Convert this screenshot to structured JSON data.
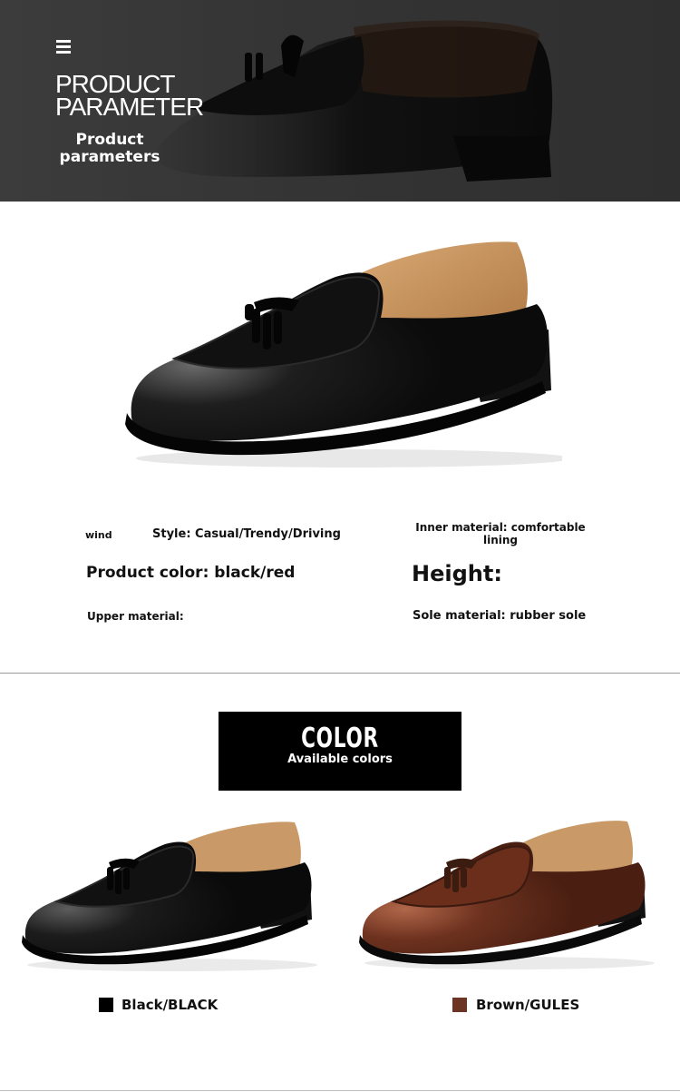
{
  "header": {
    "title_line1": "PRODUCT",
    "title_line2": "PARAMETER",
    "subtitle": "Product parameters",
    "menu_icon": "menu-icon",
    "background_color": "#353535"
  },
  "parameters": {
    "wind": "wind",
    "style": "Style: Casual/Trendy/Driving",
    "inner_material": "Inner material: comfortable lining",
    "product_color": "Product color: black/red",
    "height": "Height:",
    "upper_material": "Upper material:",
    "sole_material": "Sole material: rubber sole"
  },
  "color_section": {
    "title": "COLOR",
    "subtitle": "Available colors"
  },
  "variants": [
    {
      "label": "Black/BLACK",
      "swatch_color": "#000000"
    },
    {
      "label": "Brown/GULES",
      "swatch_color": "#6b3423"
    }
  ]
}
